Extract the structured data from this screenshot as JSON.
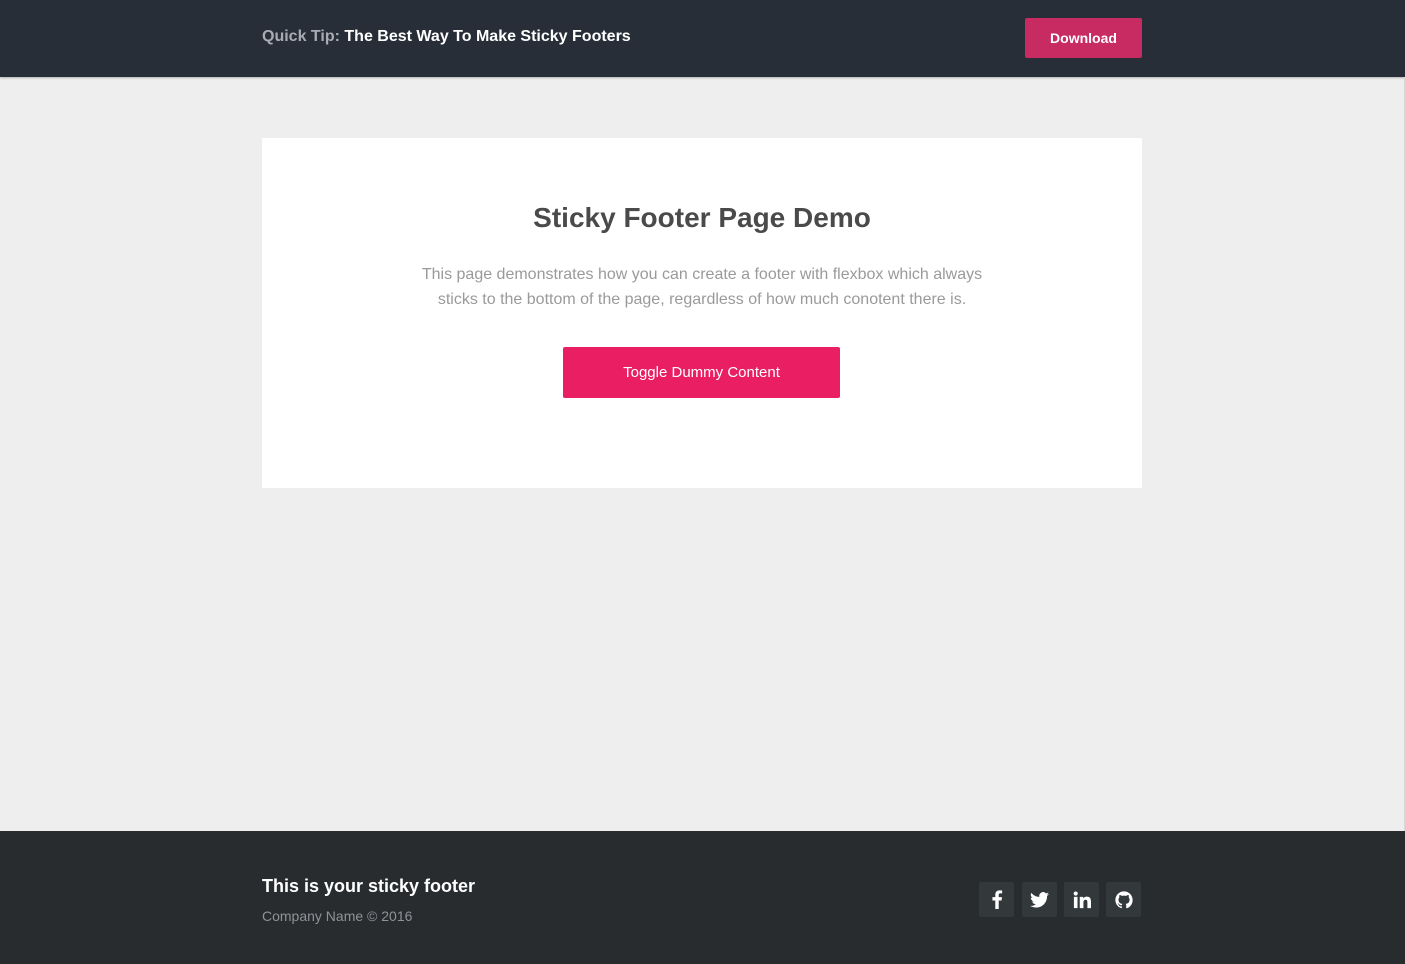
{
  "header": {
    "prefix": "Quick Tip:",
    "title": "The Best Way To Make Sticky Footers",
    "download_label": "Download"
  },
  "main": {
    "heading": "Sticky Footer Page Demo",
    "description": "This page demonstrates how you can create a footer with flexbox which always sticks to the bottom of the page, regardless of how much conotent there is.",
    "toggle_label": "Toggle Dummy Content"
  },
  "footer": {
    "title": "This is your sticky footer",
    "copyright": "Company Name © 2016",
    "social": [
      {
        "icon": "facebook-icon"
      },
      {
        "icon": "twitter-icon"
      },
      {
        "icon": "linkedin-icon"
      },
      {
        "icon": "github-icon"
      }
    ]
  },
  "colors": {
    "header_bg": "#272e38",
    "accent_header": "#c72b61",
    "accent": "#e91e63",
    "page_bg": "#eeeeee",
    "footer_bg": "#292c2f",
    "social_bg": "#33383b"
  }
}
